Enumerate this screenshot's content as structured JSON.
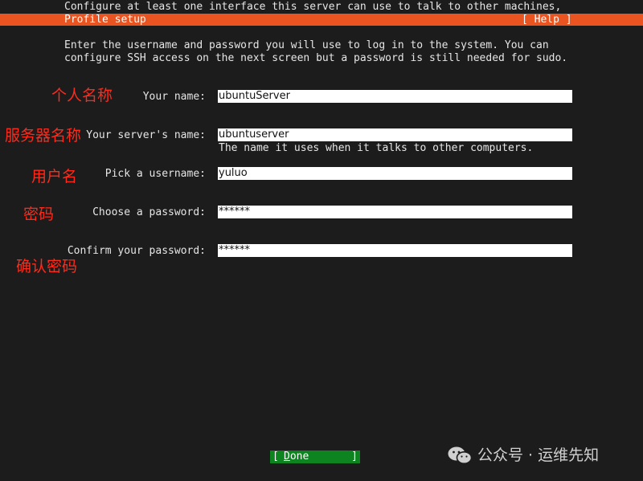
{
  "top_line": "Configure at least one interface this server can use to talk to other machines,",
  "header": {
    "title": "Profile setup",
    "help": "[ Help ]"
  },
  "intro": "Enter the username and password you will use to log in to the system. You can configure SSH access on the next screen but a password is still needed for sudo.",
  "form": {
    "name": {
      "label": "Your name:",
      "value": "ubuntuServer"
    },
    "server_name": {
      "label": "Your server's name:",
      "value": "ubuntuserver",
      "hint": "The name it uses when it talks to other computers."
    },
    "username": {
      "label": "Pick a username:",
      "value": "yuluo"
    },
    "password": {
      "label": "Choose a password:",
      "value": "******"
    },
    "confirm_password": {
      "label": "Confirm your password:",
      "value": "******"
    }
  },
  "annotations": {
    "name": "个人名称",
    "server_name": "服务器名称",
    "username": "用户名",
    "password": "密码",
    "confirm_password": "确认密码"
  },
  "done": {
    "open_bracket": "[",
    "label": "Done",
    "close_bracket": "]"
  },
  "watermark": {
    "icon": "wechat-icon",
    "text": "公众号 · 运维先知"
  },
  "colors": {
    "background": "#1c1c1c",
    "header": "#e95420",
    "done_button": "#0e8420",
    "annotation": "#ff2a1a",
    "field": "#ffffff"
  }
}
